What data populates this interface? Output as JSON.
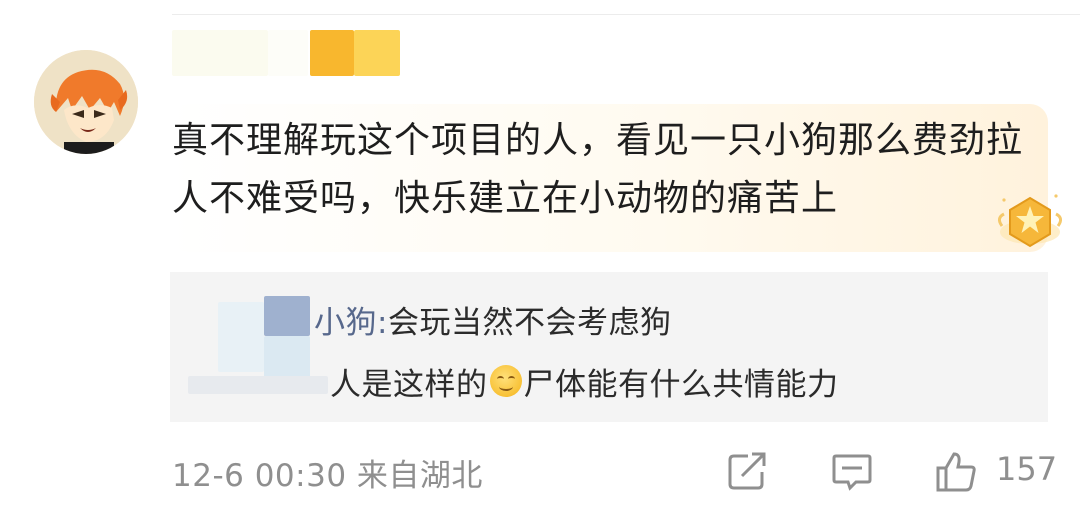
{
  "comment": {
    "avatar_icon": "anime-avatar-icon",
    "username": "",
    "text": "真不理解玩这个项目的人，看见一只小狗那么费劲拉人不难受吗，快乐建立在小动物的痛苦上",
    "badge_icon": "star-badge-icon"
  },
  "replies": [
    {
      "name_suffix": "小狗:",
      "text": " 会玩当然不会考虑狗"
    },
    {
      "text_before": "人是这样的",
      "emoji": "smile-emoji",
      "text_after": "尸体能有什么共情能力"
    }
  ],
  "footer": {
    "time_location": "12-6 00:30 来自湖北",
    "share_icon": "share-icon",
    "reply_icon": "comment-icon",
    "like_icon": "thumbs-up-icon",
    "like_count": "157"
  },
  "colors": {
    "accent_highlight": "#fff2dc",
    "reply_background": "#f4f4f4",
    "reply_name": "#57688c",
    "meta_text": "#8f8f8f"
  }
}
